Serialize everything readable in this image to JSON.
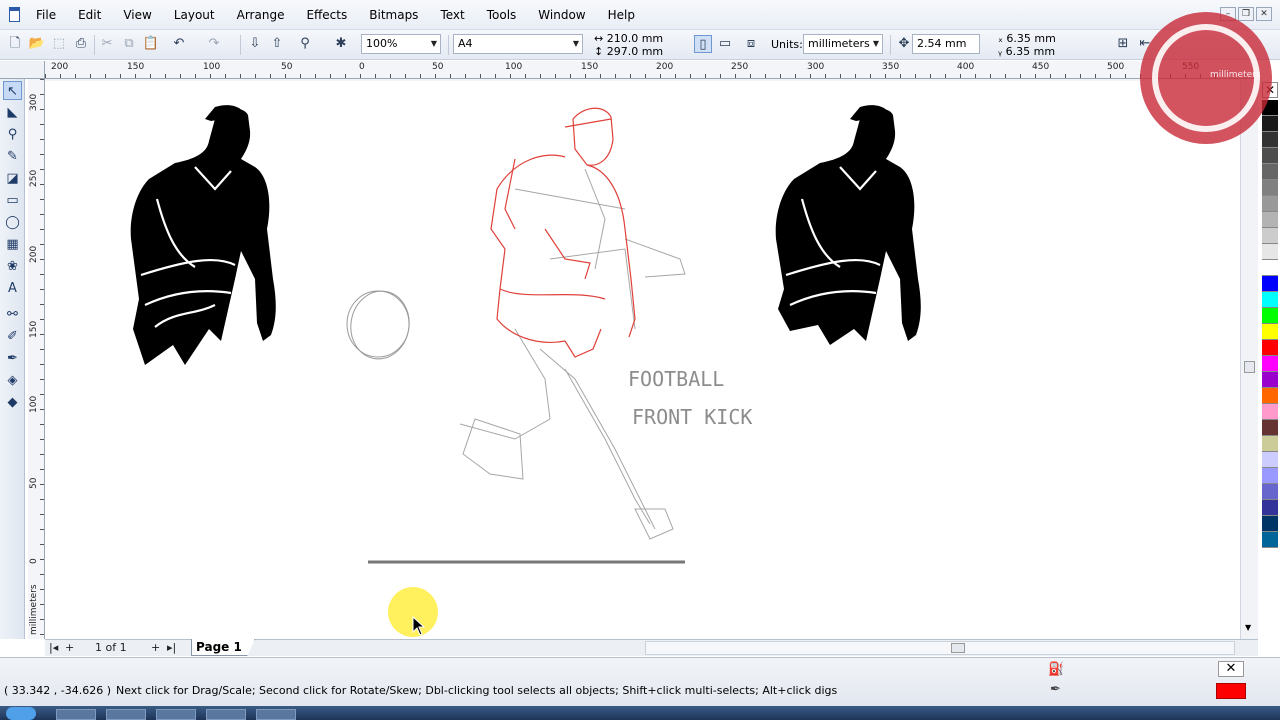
{
  "menu": {
    "items": [
      "File",
      "Edit",
      "View",
      "Layout",
      "Arrange",
      "Effects",
      "Bitmaps",
      "Text",
      "Tools",
      "Window",
      "Help"
    ]
  },
  "propbar": {
    "zoom": "100%",
    "page_size": "A4",
    "width": "210.0 mm",
    "height": "297.0 mm",
    "units_label": "Units:",
    "units_value": "millimeters",
    "nudge": "2.54 mm",
    "dup_x": "6.35 mm",
    "dup_y": "6.35 mm"
  },
  "ruler": {
    "h_labels": [
      "200",
      "150",
      "100",
      "50",
      "0",
      "50",
      "100",
      "150",
      "200",
      "250",
      "300",
      "350",
      "400",
      "450",
      "500",
      "550"
    ],
    "v_labels": [
      "300",
      "250",
      "200",
      "150",
      "100",
      "50",
      "0"
    ],
    "units_corner": "millimeters",
    "watermark_units": "millimeters"
  },
  "canvas": {
    "sketch_text_line1": "FOOTBALL",
    "sketch_text_line2": "FRONT KICK"
  },
  "pagebar": {
    "page_count": "1 of 1",
    "page_tab": "Page 1"
  },
  "status": {
    "coords": "( 33.342 , -34.626 )",
    "hint": "Next click for Drag/Scale; Second click for Rotate/Skew; Dbl-clicking tool selects all objects; Shift+click multi-selects; Alt+click digs"
  },
  "palette": [
    "#000000",
    "#1a1a1a",
    "#333333",
    "#4d4d4d",
    "#666666",
    "#808080",
    "#999999",
    "#b3b3b3",
    "#cccccc",
    "#e6e6e6",
    "#ffffff",
    "#0000ff",
    "#00ffff",
    "#00ff00",
    "#ffff00",
    "#ff0000",
    "#ff00ff",
    "#9900cc",
    "#ff6600",
    "#ff99cc",
    "#663333",
    "#cccc99",
    "#ccccff",
    "#9999ff",
    "#6666cc",
    "#333399",
    "#003366",
    "#006699"
  ],
  "colors": {
    "fill_indicator": "#ff0000",
    "sketch_red": "#e0403a",
    "silhouette": "#000000"
  }
}
